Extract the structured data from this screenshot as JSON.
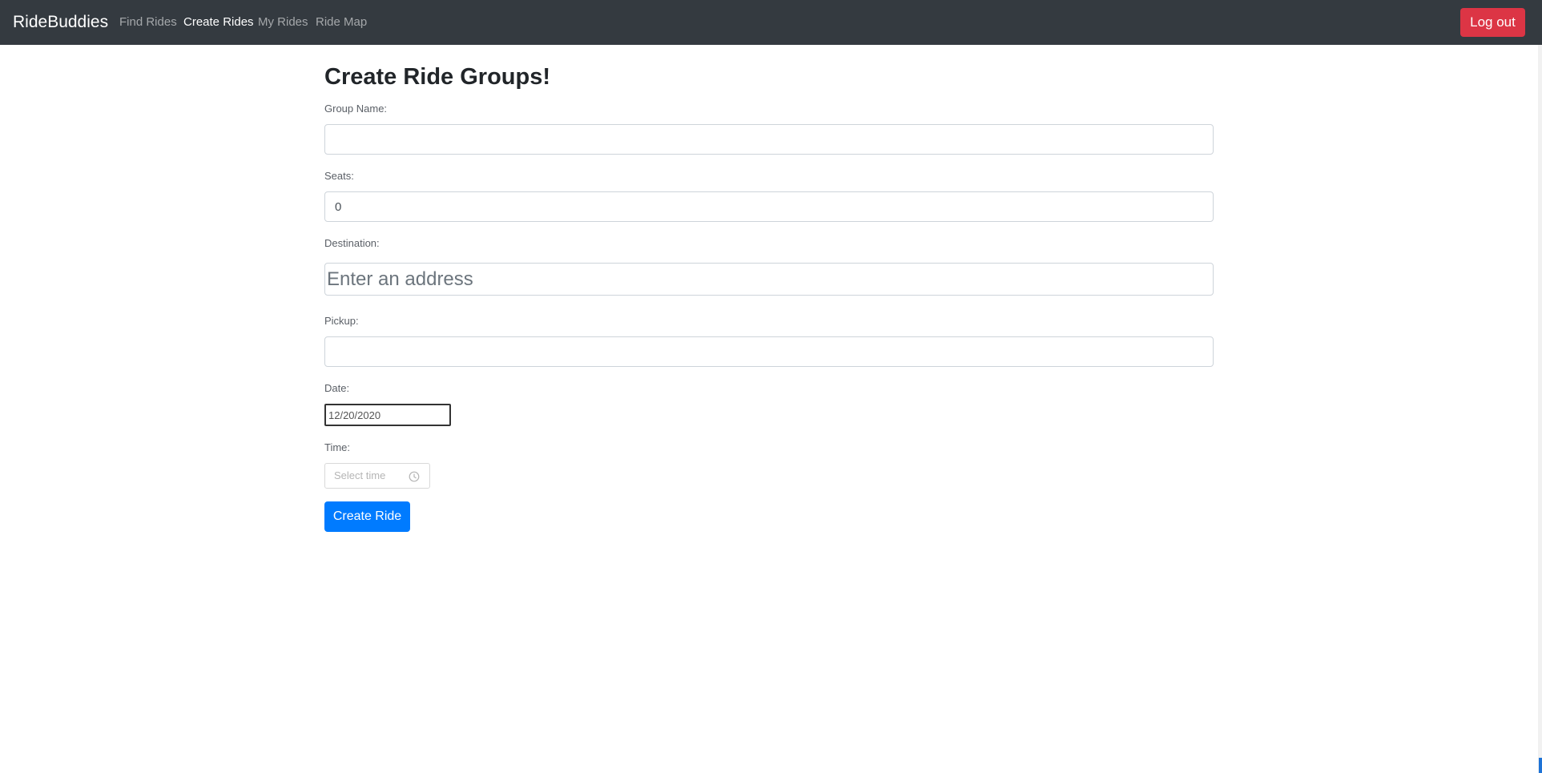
{
  "navbar": {
    "brand": "RideBuddies",
    "links": [
      {
        "label": "Find Rides",
        "active": false
      },
      {
        "label": "Create Rides",
        "active": true
      },
      {
        "label": "My Rides",
        "active": false
      },
      {
        "label": "Ride Map",
        "active": false
      }
    ],
    "logout_label": "Log out"
  },
  "form": {
    "title": "Create Ride Groups!",
    "group_name": {
      "label": "Group Name:",
      "value": ""
    },
    "seats": {
      "label": "Seats:",
      "value": "0"
    },
    "destination": {
      "label": "Destination:",
      "placeholder": "Enter an address",
      "value": ""
    },
    "pickup": {
      "label": "Pickup:",
      "value": ""
    },
    "date": {
      "label": "Date:",
      "value": "12/20/2020"
    },
    "time": {
      "label": "Time:",
      "placeholder": "Select time",
      "icon": "clock-icon"
    },
    "submit_label": "Create Ride"
  },
  "colors": {
    "navbar_bg": "#343a40",
    "logout_bg": "#dc3545",
    "primary": "#007bff"
  }
}
